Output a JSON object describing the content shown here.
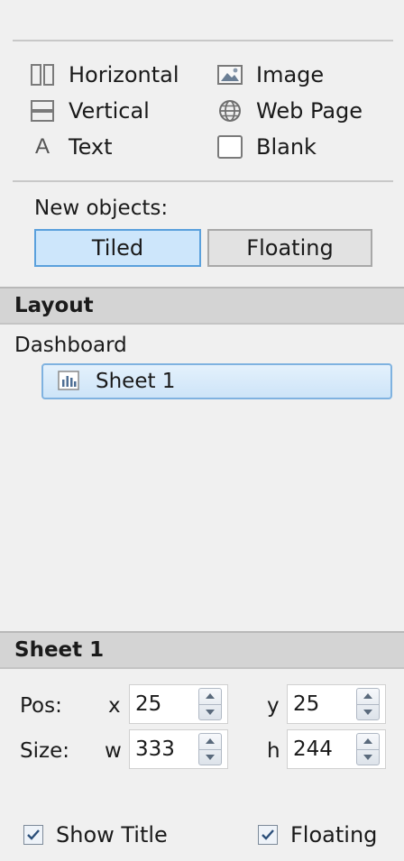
{
  "objects": {
    "horizontal": "Horizontal",
    "vertical": "Vertical",
    "text": "Text",
    "image": "Image",
    "web_page": "Web Page",
    "blank": "Blank"
  },
  "new_objects": {
    "label": "New objects:",
    "tiled": "Tiled",
    "floating": "Floating",
    "selected": "Tiled"
  },
  "layout": {
    "header": "Layout",
    "tree_root": "Dashboard",
    "tree_item": "Sheet 1"
  },
  "sheet": {
    "header": "Sheet 1",
    "pos_label": "Pos:",
    "size_label": "Size:",
    "x_label": "x",
    "y_label": "y",
    "w_label": "w",
    "h_label": "h",
    "x": "25",
    "y": "25",
    "w": "333",
    "h": "244"
  },
  "options": {
    "show_title": "Show Title",
    "show_title_checked": true,
    "floating": "Floating",
    "floating_checked": true
  },
  "colors": {
    "accent": "#cde6fb",
    "accent_border": "#5aa0dc",
    "header_bg": "#d4d4d4",
    "panel_bg": "#f0f0f0"
  }
}
